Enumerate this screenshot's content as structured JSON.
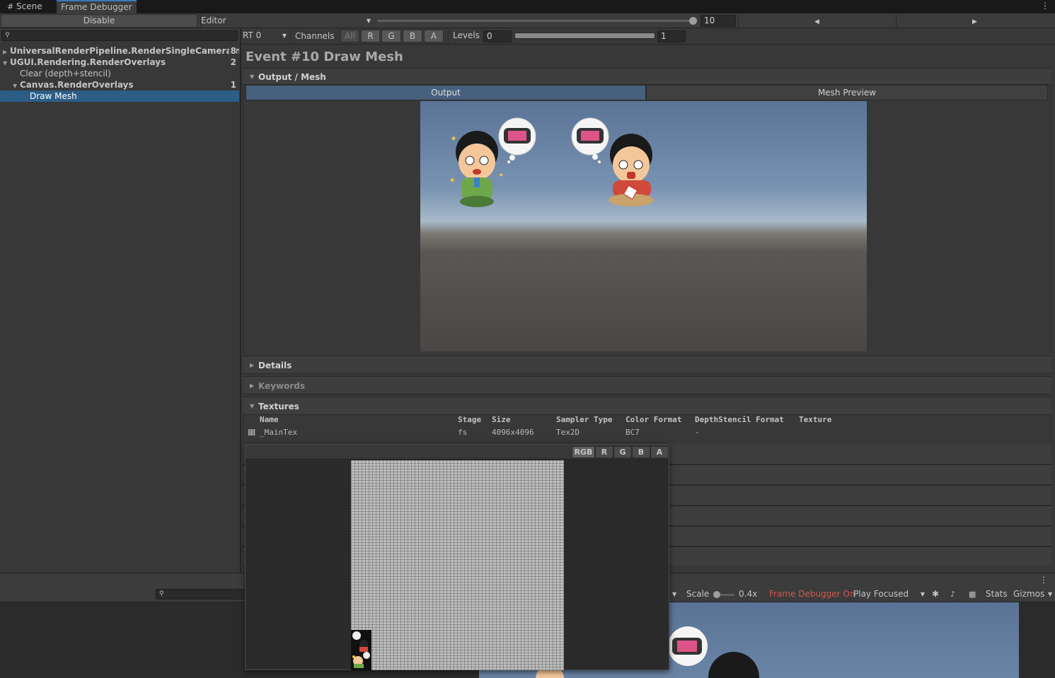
{
  "tabs": {
    "scene": "Scene",
    "frame_debugger": "Frame Debugger"
  },
  "toolbar": {
    "disable": "Disable",
    "target": "Editor",
    "event_slider": 10,
    "event_value": "10"
  },
  "render_target": {
    "rt": "RT 0",
    "channels_label": "Channels",
    "channels": [
      "All",
      "R",
      "G",
      "B",
      "A"
    ],
    "levels_label": "Levels",
    "levels_min": "0",
    "levels_max": "1"
  },
  "tree": [
    {
      "label": "UniversalRenderPipeline.RenderSingleCameraInternal",
      "count": "8",
      "indent": 0,
      "expanded": false,
      "bold": true
    },
    {
      "label": "UGUI.Rendering.RenderOverlays",
      "count": "2",
      "indent": 0,
      "expanded": true,
      "bold": true
    },
    {
      "label": "Clear (depth+stencil)",
      "count": "",
      "indent": 1,
      "expanded": null,
      "bold": false
    },
    {
      "label": "Canvas.RenderOverlays",
      "count": "1",
      "indent": 1,
      "expanded": true,
      "bold": true
    },
    {
      "label": "Draw Mesh",
      "count": "",
      "indent": 2,
      "expanded": null,
      "bold": false,
      "selected": true
    }
  ],
  "event_title": "Event #10 Draw Mesh",
  "sections": {
    "output_mesh": "Output / Mesh",
    "output_tab": "Output",
    "mesh_preview_tab": "Mesh Preview",
    "details": "Details",
    "keywords": "Keywords",
    "textures": "Textures"
  },
  "textures_table": {
    "headers": [
      "Name",
      "Stage",
      "Size",
      "Sampler Type",
      "Color Format",
      "DepthStencil Format",
      "Texture"
    ],
    "rows": [
      {
        "name": "_MainTex",
        "stage": "fs",
        "size": "4096x4096",
        "sampler": "Tex2D",
        "color_format": "BC7",
        "depth_format": "-"
      }
    ]
  },
  "popup_channels": [
    "RGB",
    "R",
    "G",
    "B",
    "A"
  ],
  "game_toolbar": {
    "scale_label": "Scale",
    "scale_value": "0.4x",
    "frame_debugger_on": "Frame Debugger On",
    "play_mode": "Play Focused",
    "stats": "Stats",
    "gizmos": "Gizmos"
  },
  "colors": {
    "accent": "#3a79bb",
    "selection": "#2c5d87",
    "frame_debugger_on": "#d0574f"
  }
}
